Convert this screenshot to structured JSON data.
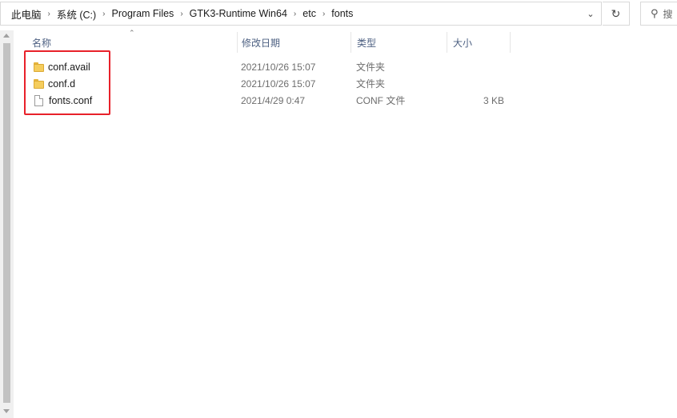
{
  "address_bar": {
    "breadcrumbs": [
      "此电脑",
      "系统 (C:)",
      "Program Files",
      "GTK3-Runtime Win64",
      "etc",
      "fonts"
    ],
    "separator": "›"
  },
  "search": {
    "placeholder": "搜"
  },
  "columns": {
    "name": "名称",
    "modified": "修改日期",
    "type": "类型",
    "size": "大小"
  },
  "files": [
    {
      "name": "conf.avail",
      "modified": "2021/10/26 15:07",
      "type": "文件夹",
      "size": "",
      "icon": "folder-icon"
    },
    {
      "name": "conf.d",
      "modified": "2021/10/26 15:07",
      "type": "文件夹",
      "size": "",
      "icon": "folder-icon"
    },
    {
      "name": "fonts.conf",
      "modified": "2021/4/29 0:47",
      "type": "CONF 文件",
      "size": "3 KB",
      "icon": "file-icon"
    }
  ],
  "colors": {
    "highlight": "#e8212a",
    "header_text": "#4d6082",
    "folder": "#f5cd5d"
  }
}
